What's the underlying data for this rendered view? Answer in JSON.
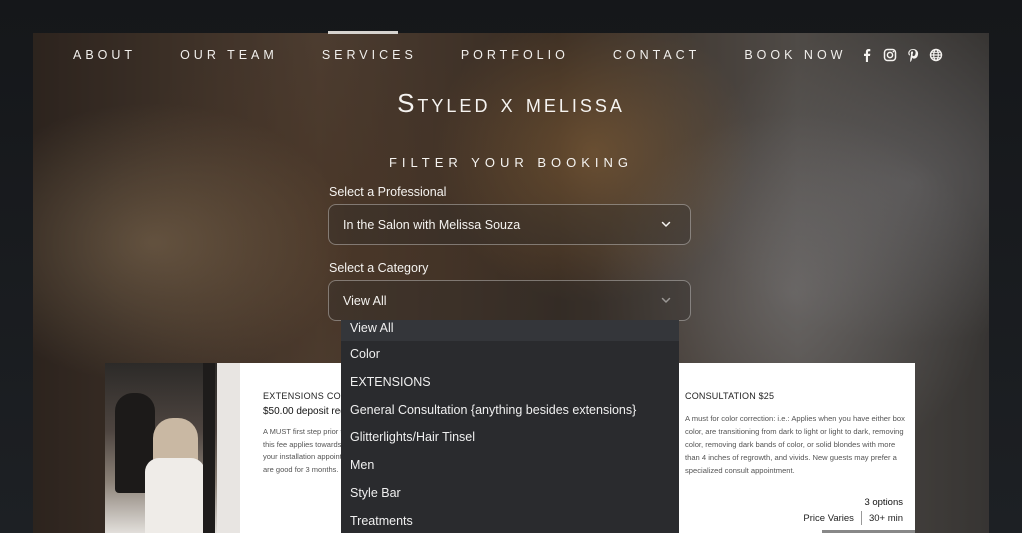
{
  "nav": {
    "items": [
      "ABOUT",
      "OUR TEAM",
      "SERVICES",
      "PORTFOLIO",
      "CONTACT",
      "BOOK NOW"
    ],
    "active": "SERVICES"
  },
  "social": [
    "facebook-icon",
    "instagram-icon",
    "pinterest-icon",
    "globe-icon"
  ],
  "brand": "Styled x melissa",
  "filter": {
    "title": "FILTER YOUR BOOKING",
    "professional_label": "Select a Professional",
    "professional_value": "In the Salon with Melissa Souza",
    "category_label": "Select a Category",
    "category_value": "View All",
    "category_options": [
      "View All",
      "Color",
      "EXTENSIONS",
      "General Consultation {anything besides extensions}",
      "Glitterlights/Hair Tinsel",
      "Men",
      "Style Bar",
      "Treatments"
    ]
  },
  "cards": {
    "left": {
      "title": "EXTENSIONS CONSULTATION",
      "deposit": "$50.00 deposit required",
      "desc": [
        "A MUST first step prior to booking extensions.",
        "this fee applies towards your extension service.",
        "your installation appointment must be booked,",
        "are good for 3 months."
      ]
    },
    "right": {
      "title": "CONSULTATION $25",
      "desc": "A must for color correction: i.e.: Applies when you have either box color, are transitioning from dark to light or light to dark, removing color, removing dark bands of color, or solid blondes with more than 4 inches of regrowth, and vivids. New guests may prefer a specialized consult appointment.",
      "options": "3 options",
      "price": "Price Varies",
      "duration": "30+ min"
    }
  }
}
